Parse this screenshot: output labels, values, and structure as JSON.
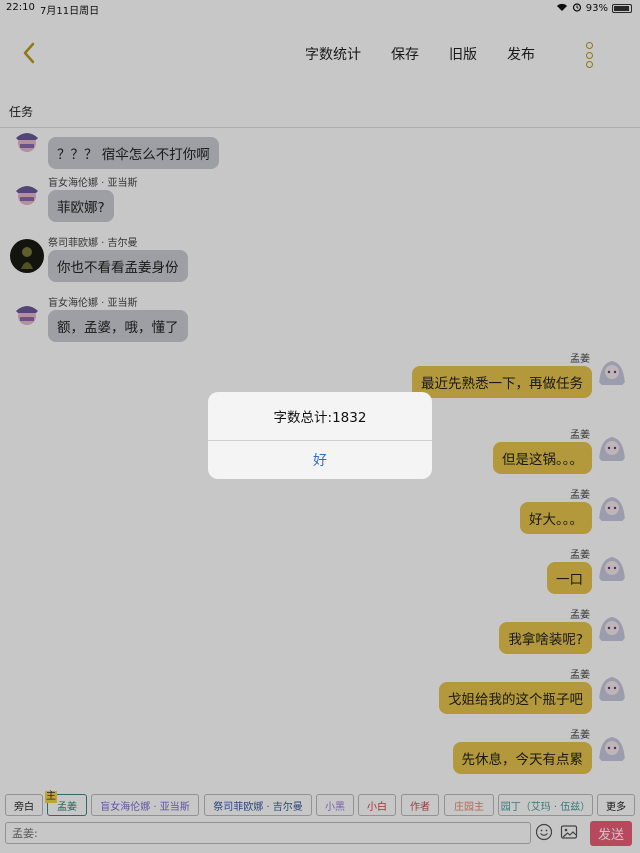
{
  "status_bar": {
    "time": "22:10",
    "date": "7月11日周日",
    "battery": "93%",
    "battery_level": 0.93
  },
  "nav": {
    "back_icon": "chevron-left-icon",
    "actions": [
      "字数统计",
      "保存",
      "旧版",
      "发布"
    ],
    "more_icon": "vertical-dots-icon"
  },
  "task_label": "任务",
  "messages_left": [
    {
      "name": "",
      "text": "？？？ 宿伞怎么不打你啊"
    },
    {
      "name": "盲女海伦娜 · 亚当斯",
      "text": "菲欧娜?"
    },
    {
      "name": "祭司菲欧娜 · 吉尔曼",
      "text": "你也不看看孟姜身份"
    },
    {
      "name": "盲女海伦娜 · 亚当斯",
      "text": "额，孟婆，哦，懂了"
    }
  ],
  "messages_right": [
    {
      "name": "孟姜",
      "text": "最近先熟悉一下，再做任务"
    },
    {
      "name": "孟姜",
      "text": "但是这锅。。。"
    },
    {
      "name": "孟姜",
      "text": "好大。。。"
    },
    {
      "name": "孟姜",
      "text": "一口"
    },
    {
      "name": "孟姜",
      "text": "我拿啥装呢?"
    },
    {
      "name": "孟姜",
      "text": "戈姐给我的这个瓶子吧"
    },
    {
      "name": "孟姜",
      "text": "先休息，今天有点累"
    }
  ],
  "dialog": {
    "title": "字数总计:1832",
    "ok": "好"
  },
  "tags": {
    "host_badge": "主",
    "items": [
      {
        "label": "旁白",
        "color": "#222222"
      },
      {
        "label": "孟姜",
        "color": "#2f7f6e"
      },
      {
        "label": "盲女海伦娜 · 亚当斯",
        "color": "#7b6bd0"
      },
      {
        "label": "祭司菲欧娜 · 吉尔曼",
        "color": "#3a5ba0"
      },
      {
        "label": "小黑",
        "color": "#9a7bd8"
      },
      {
        "label": "小白",
        "color": "#d04040"
      },
      {
        "label": "作者",
        "color": "#c05050"
      },
      {
        "label": "庄园主",
        "color": "#e08a6a"
      },
      {
        "label": "园丁（艾玛 · 伍兹）",
        "color": "#4a9c9c"
      },
      {
        "label": "更多",
        "color": "#222222"
      }
    ]
  },
  "input": {
    "placeholder": "孟姜:",
    "send_label": "发送",
    "emoji_icon": "smiley-icon",
    "image_icon": "image-icon"
  },
  "colors": {
    "accent": "#b99a1e",
    "left_bubble": "#c9ccd3",
    "right_bubble": "#e6c54c",
    "send": "#e95f77",
    "dialog_button": "#2a6fd6"
  }
}
